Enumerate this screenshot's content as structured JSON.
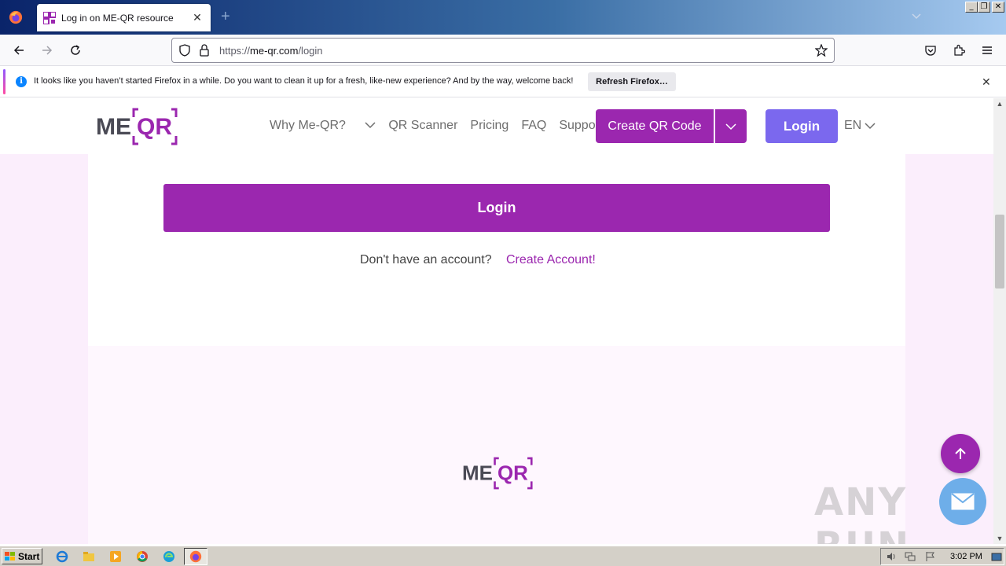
{
  "browser": {
    "tab_title": "Log in on ME-QR resource",
    "url_prefix": "https://",
    "url_domain": "me-qr.com",
    "url_path": "/login"
  },
  "notification": {
    "message": "It looks like you haven’t started Firefox in a while. Do you want to clean it up for a fresh, like-new experience? And by the way, welcome back!",
    "action_label": "Refresh Firefox…"
  },
  "site": {
    "logo_text": "MEQR",
    "nav": [
      "Why Me-QR?",
      "QR Scanner",
      "Pricing",
      "FAQ",
      "Support"
    ],
    "create_qr_label": "Create QR Code",
    "header_login_label": "Login",
    "language": "EN"
  },
  "login": {
    "button_label": "Login",
    "no_account_text": "Don't have an account?",
    "create_account_label": "Create Account!"
  },
  "watermark": "ANY RUN",
  "taskbar": {
    "start_label": "Start",
    "clock": "3:02 PM"
  },
  "colors": {
    "brand_purple": "#9b27af",
    "login_violet": "#7b68ee",
    "page_pink": "#fbeefc"
  }
}
